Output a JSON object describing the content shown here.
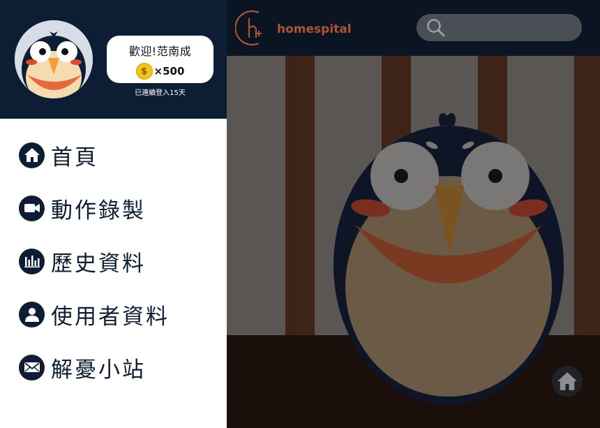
{
  "profile": {
    "welcome": "歡迎!范南成",
    "coin_count": "×500",
    "coin_symbol": "$",
    "streak": "已連續登入15天"
  },
  "menu": {
    "items": [
      {
        "label": "首頁",
        "icon": "home-icon"
      },
      {
        "label": "動作錄製",
        "icon": "video-camera-icon"
      },
      {
        "label": "歷史資料",
        "icon": "bar-chart-icon"
      },
      {
        "label": "使用者資料",
        "icon": "user-icon"
      },
      {
        "label": "解憂小站",
        "icon": "mail-icon"
      }
    ]
  },
  "header": {
    "logo_text": "homespital",
    "search_placeholder": ""
  },
  "colors": {
    "navy": "#0d1d33",
    "brand_orange": "#b0532f",
    "coin_gold": "#f4c414"
  }
}
